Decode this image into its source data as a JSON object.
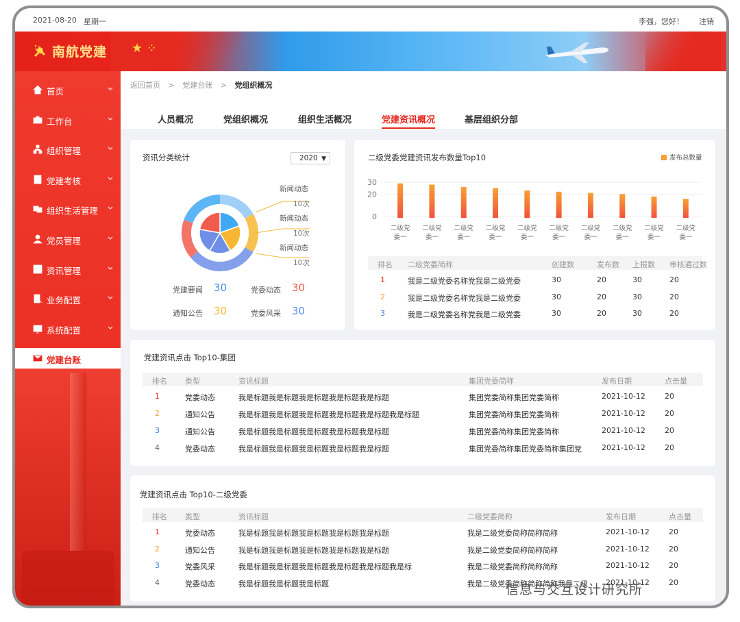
{
  "topbar": {
    "date": "2021-08-20",
    "weekday": "星期一",
    "greeting": "李强，您好！",
    "logout": "注销"
  },
  "banner": {
    "brand": "南航党建"
  },
  "sidebar": {
    "items": [
      {
        "label": "首页",
        "icon": "home-icon"
      },
      {
        "label": "工作台",
        "icon": "briefcase-icon"
      },
      {
        "label": "组织管理",
        "icon": "org-icon"
      },
      {
        "label": "党建考核",
        "icon": "assessment-icon"
      },
      {
        "label": "组织生活管理",
        "icon": "group-icon"
      },
      {
        "label": "党员管理",
        "icon": "member-icon"
      },
      {
        "label": "资讯管理",
        "icon": "news-icon"
      },
      {
        "label": "业务配置",
        "icon": "config-icon"
      },
      {
        "label": "系统配置",
        "icon": "system-icon"
      },
      {
        "label": "党建台账",
        "icon": "ledger-icon"
      }
    ],
    "active_index": 9
  },
  "breadcrumb": {
    "home": "返回首页",
    "parent": "党建台账",
    "current": "党组织概况"
  },
  "tabs": [
    "人员概况",
    "党组织概况",
    "组织生活概况",
    "党建资讯概况",
    "基层组织分部"
  ],
  "active_tab": 3,
  "pie_card": {
    "title": "资讯分类统计",
    "year": "2020",
    "callouts": [
      {
        "name": "新闻动态",
        "count": "10次"
      },
      {
        "name": "新闻动态",
        "count": "10次"
      },
      {
        "name": "新闻动态",
        "count": "10次"
      }
    ],
    "stats": [
      {
        "label": "党建要闻",
        "value": "30",
        "color": "#4a90e2"
      },
      {
        "label": "党委动态",
        "value": "30",
        "color": "#f05a4a"
      },
      {
        "label": "通知公告",
        "value": "30",
        "color": "#f7b733"
      },
      {
        "label": "党委风采",
        "value": "30",
        "color": "#5b8def"
      }
    ],
    "colors": [
      "#f25c4c",
      "#f7b733",
      "#6f8fe6",
      "#3fa9f5",
      "#8fc8f7"
    ]
  },
  "chart_data": {
    "type": "bar",
    "title": "二级党委党建资讯发布数量Top10",
    "legend": "发布总数量",
    "categories": [
      "二级党委一",
      "二级党委一",
      "二级党委一",
      "二级党委一",
      "二级党委一",
      "二级党委一",
      "二级党委一",
      "二级党委一",
      "二级党委一",
      "二级党委一"
    ],
    "category_lines": [
      "二级党",
      "委一"
    ],
    "values": [
      29,
      28,
      26,
      25,
      23,
      22,
      21,
      20,
      18,
      16
    ],
    "yticks": [
      "30",
      "20",
      "0"
    ],
    "ylim": [
      0,
      30
    ]
  },
  "rank_table": {
    "headers": [
      "排名",
      "二级党委简称",
      "创建数",
      "发布数",
      "上报数",
      "审核通过数"
    ],
    "rows": [
      [
        "1",
        "我是二级党委名称党我是二级党委",
        "30",
        "20",
        "30",
        "20"
      ],
      [
        "2",
        "我是二级党委名称党我是二级党委",
        "30",
        "20",
        "30",
        "20"
      ],
      [
        "3",
        "我是二级党委名称党我是二级党委",
        "30",
        "20",
        "30",
        "20"
      ]
    ]
  },
  "group_table": {
    "title": "党建资讯点击 Top10-集团",
    "headers": [
      "排名",
      "类型",
      "资讯标题",
      "集团党委简称",
      "发布日期",
      "点击量"
    ],
    "rows": [
      [
        "1",
        "党委动态",
        "我是标题我是标题我是标题我是标题我是标题",
        "集团党委简称集团党委简称",
        "2021-10-12",
        "20"
      ],
      [
        "2",
        "通知公告",
        "我是标题我是标题我是标题我是标题我是标题我是标题",
        "集团党委简称集团党委简称",
        "2021-10-12",
        "20"
      ],
      [
        "3",
        "通知公告",
        "我是标题我是标题我是标题我是标题我是标题",
        "集团党委简称集团党委简称",
        "2021-10-12",
        "20"
      ],
      [
        "4",
        "党委动态",
        "我是标题我是标题我是标题我是标题我是标题",
        "集团党委简称集团党委简称集团党",
        "2021-10-12",
        "20"
      ]
    ]
  },
  "second_table": {
    "title": "党建资讯点击 Top10-二级党委",
    "headers": [
      "排名",
      "类型",
      "资讯标题",
      "二级党委简称",
      "发布日期",
      "点击量"
    ],
    "rows": [
      [
        "1",
        "党委动态",
        "我是标题我是标题我是标题我是标题我是标题",
        "我是二级党委简称简称简称",
        "2021-10-12",
        "20"
      ],
      [
        "2",
        "通知公告",
        "我是标题我是标题我是标题我是标题我是标题",
        "我是二级党委简称简称简称",
        "2021-10-12",
        "20"
      ],
      [
        "3",
        "党委风采",
        "我是标题我是标题我是标题我是标题我是标题我是标",
        "我是二级党委简称简称简称",
        "2021-10-12",
        "20"
      ],
      [
        "4",
        "党委动态",
        "我是标题我是标题我是标题",
        "我是二级党委简称简称简称我是二级",
        "2021-10-12",
        "20"
      ]
    ]
  },
  "rank_colors": [
    "#e8261c",
    "#f7a034",
    "#4a7fe0",
    "#666666"
  ],
  "watermark": "信息与交互设计研究所"
}
